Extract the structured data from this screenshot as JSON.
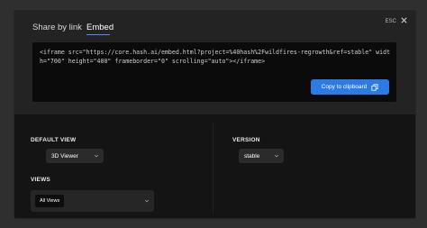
{
  "tabs": [
    {
      "label": "Share by link",
      "active": false
    },
    {
      "label": "Embed",
      "active": true
    }
  ],
  "esc_label": "ESC",
  "embed_code": "<iframe src=\"https://core.hash.ai/embed.html?project=%40hash%2Fwildfires-regrowth&ref=stable\" width=\"700\" height=\"400\" frameborder=\"0\" scrolling=\"auto\"></iframe>",
  "copy_button_label": "Copy to clipboard",
  "default_view": {
    "label": "DEFAULT VIEW",
    "value": "3D Viewer"
  },
  "version": {
    "label": "VERSION",
    "value": "stable"
  },
  "views": {
    "label": "VIEWS",
    "selected": "All Views"
  },
  "colors": {
    "accent": "#2c7be5",
    "tab_underline": "#4f8cff"
  },
  "icons": {
    "close": "close-icon",
    "copy": "copy-icon",
    "dropdown": "chevron-down-icon"
  }
}
